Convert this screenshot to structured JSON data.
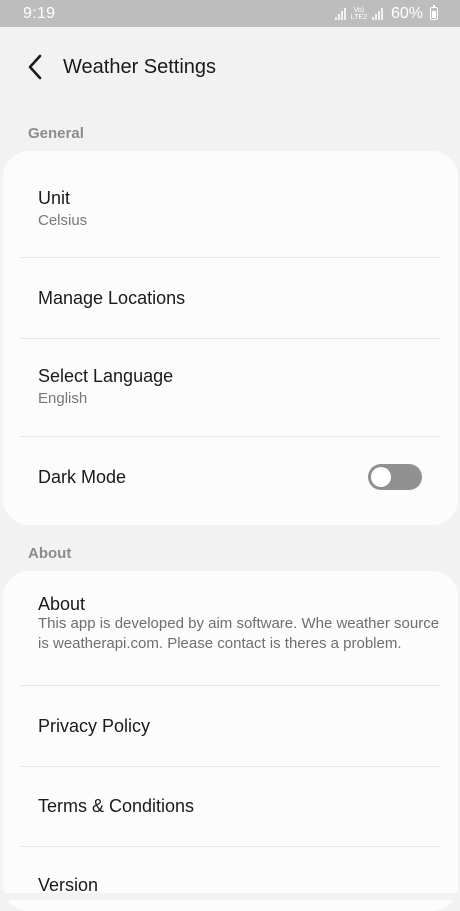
{
  "status_bar": {
    "time": "9:19",
    "network_top": "Vo)",
    "network_bottom": "LTE2",
    "battery_percent": "60%"
  },
  "header": {
    "title": "Weather Settings"
  },
  "general": {
    "header": "General",
    "unit": {
      "title": "Unit",
      "value": "Celsius"
    },
    "manage_locations": {
      "title": "Manage Locations"
    },
    "language": {
      "title": "Select Language",
      "value": "English"
    },
    "dark_mode": {
      "title": "Dark Mode",
      "enabled": false
    }
  },
  "about": {
    "header": "About",
    "about_item": {
      "title": "About",
      "description": "This app is developed by aim software. Whe weather source is weatherapi.com. Please contact is theres a problem."
    },
    "privacy": {
      "title": "Privacy Policy"
    },
    "terms": {
      "title": "Terms & Conditions"
    },
    "version": {
      "title": "Version"
    }
  },
  "icons": {
    "back": "chevron-left-icon",
    "signal": "signal-icon",
    "battery": "battery-icon"
  }
}
